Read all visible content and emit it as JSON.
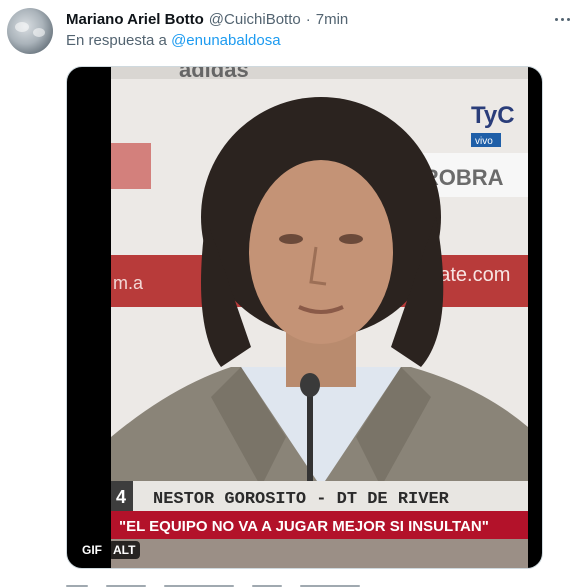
{
  "tweet": {
    "author_name": "Mariano Ariel Botto",
    "author_handle": "@CuichiBotto",
    "separator": "·",
    "time": "7min",
    "reply_prefix": "En respuesta a",
    "reply_to": "@enunabaldosa",
    "more_icon": "more-horizontal-icon"
  },
  "media": {
    "gif_badge": "GIF",
    "alt_badge": "ALT",
    "frame_text": {
      "sponsor_top": "adidas",
      "broadcaster": "TyC",
      "broadcaster_sub": "vivo",
      "sponsor_mid": "KROBRA",
      "sponsor_left": "m.a",
      "website": "rplate.com",
      "lower_third_number": "4",
      "lower_third_name": "NESTOR GOROSITO - DT DE RIVER",
      "quote": "\"EL EQUIPO NO VA A JUGAR MEJOR SI INSULTAN\""
    }
  },
  "colors": {
    "accent_link": "#1d9bf0",
    "text_primary": "#0f1419",
    "text_secondary": "#536471",
    "ticker_red": "#b3122a"
  }
}
